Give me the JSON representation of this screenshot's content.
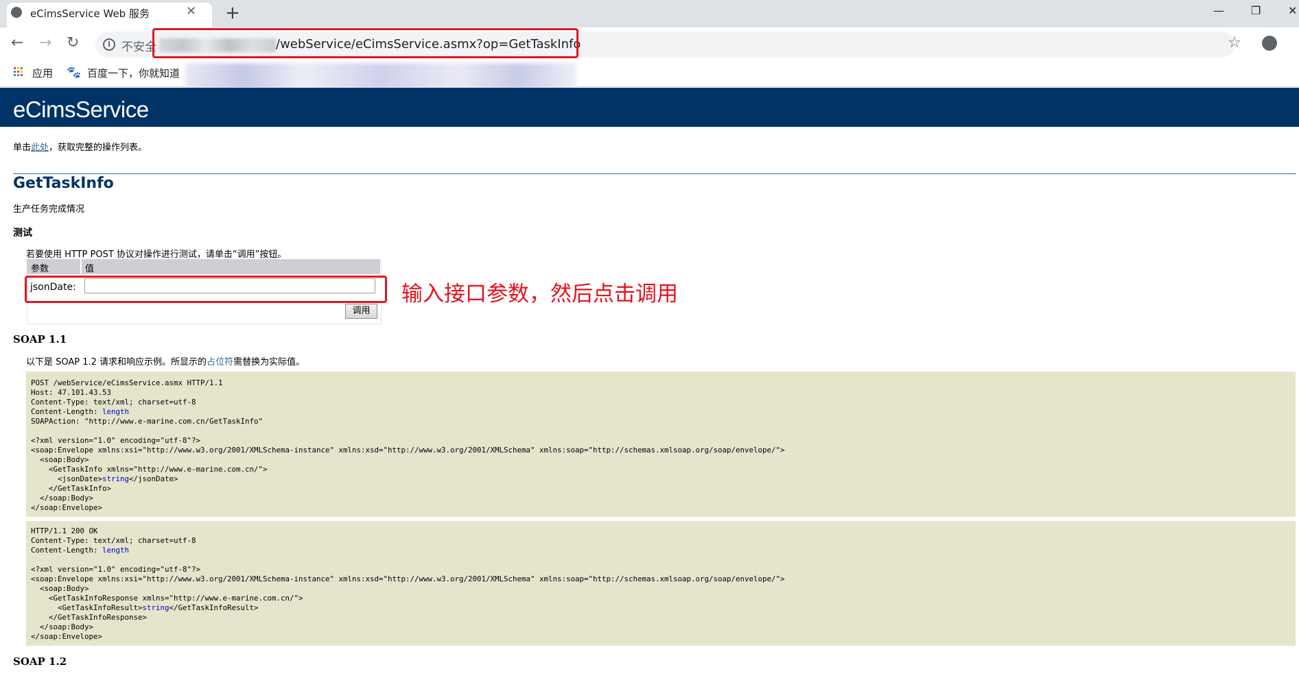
{
  "browser": {
    "tab_title": "eCimsService Web 服务",
    "tab_close": "✕",
    "new_tab": "+",
    "window_controls": {
      "minimize": "—",
      "restore": "❐",
      "close": "✕"
    },
    "nav": {
      "back": "←",
      "forward": "→",
      "reload": "↻"
    },
    "security_label": "不安全",
    "url_visible": "/webService/eCimsService.asmx?op=GetTaskInfo",
    "star": "☆",
    "bookmarks": [
      {
        "label": "应用",
        "icon": "apps-grid-icon"
      },
      {
        "label": "百度一下，你就知道",
        "icon": "baidu-paw-icon"
      }
    ]
  },
  "annotation": {
    "text": "输入接口参数，然后点击调用",
    "color": "#e8121e"
  },
  "page": {
    "title": "eCimsService",
    "intro_prefix": "单击",
    "intro_link": "此处",
    "intro_suffix": "，获取完整的操作列表。",
    "operation_name": "GetTaskInfo",
    "operation_desc": "生产任务完成情况",
    "test_heading": "测试",
    "test_instruction": "若要使用 HTTP POST 协议对操作进行测试，请单击“调用”按钮。",
    "table": {
      "col_param": "参数",
      "col_value": "值",
      "param_name": "jsonDate:",
      "param_value": "",
      "invoke_button": "调用"
    },
    "soap11": {
      "heading": "SOAP 1.1",
      "desc_prefix": "以下是 SOAP 1.2 请求和响应示例。所显示的",
      "desc_placeholder": "占位符",
      "desc_suffix": "需替换为实际值。"
    },
    "soap12": {
      "heading": "SOAP 1.2"
    },
    "colors": {
      "header_band": "#003366",
      "code_bg": "#e5e5cc",
      "link": "#336699"
    }
  },
  "request_code": [
    [
      "POST /webService/eCimsService.asmx HTTP/1.1",
      ""
    ],
    [
      "Host: 47.101.43.53",
      ""
    ],
    [
      "Content-Type: text/xml; charset=utf-8",
      ""
    ],
    [
      "Content-Length: ",
      "length"
    ],
    [
      "SOAPAction: \"http://www.e-marine.com.cn/GetTaskInfo\"",
      ""
    ],
    [
      "",
      ""
    ],
    [
      "<?xml version=\"1.0\" encoding=\"utf-8\"?>",
      ""
    ],
    [
      "<soap:Envelope xmlns:xsi=\"http://www.w3.org/2001/XMLSchema-instance\" xmlns:xsd=\"http://www.w3.org/2001/XMLSchema\" xmlns:soap=\"http://schemas.xmlsoap.org/soap/envelope/\">",
      ""
    ],
    [
      "  <soap:Body>",
      ""
    ],
    [
      "    <GetTaskInfo xmlns=\"http://www.e-marine.com.cn/\">",
      ""
    ],
    [
      "      <jsonDate>",
      "string",
      "</jsonDate>"
    ],
    [
      "    </GetTaskInfo>",
      ""
    ],
    [
      "  </soap:Body>",
      ""
    ],
    [
      "</soap:Envelope>",
      ""
    ]
  ],
  "response_code": [
    [
      "HTTP/1.1 200 OK",
      ""
    ],
    [
      "Content-Type: text/xml; charset=utf-8",
      ""
    ],
    [
      "Content-Length: ",
      "length"
    ],
    [
      "",
      ""
    ],
    [
      "<?xml version=\"1.0\" encoding=\"utf-8\"?>",
      ""
    ],
    [
      "<soap:Envelope xmlns:xsi=\"http://www.w3.org/2001/XMLSchema-instance\" xmlns:xsd=\"http://www.w3.org/2001/XMLSchema\" xmlns:soap=\"http://schemas.xmlsoap.org/soap/envelope/\">",
      ""
    ],
    [
      "  <soap:Body>",
      ""
    ],
    [
      "    <GetTaskInfoResponse xmlns=\"http://www.e-marine.com.cn/\">",
      ""
    ],
    [
      "      <GetTaskInfoResult>",
      "string",
      "</GetTaskInfoResult>"
    ],
    [
      "    </GetTaskInfoResponse>",
      ""
    ],
    [
      "  </soap:Body>",
      ""
    ],
    [
      "</soap:Envelope>",
      ""
    ]
  ]
}
